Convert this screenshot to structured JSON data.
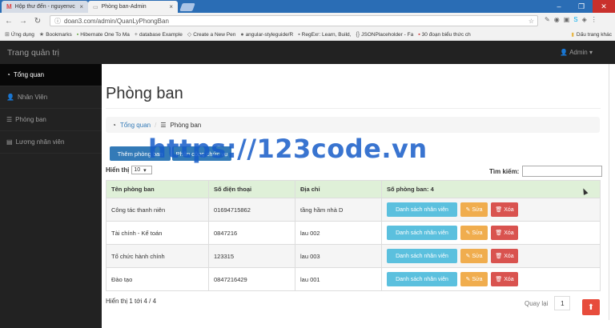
{
  "browser": {
    "tabs": [
      {
        "label": "Hộp thư đến - nguyenvc",
        "icon": "gmail-icon",
        "active": false
      },
      {
        "label": "Phòng ban-Admin",
        "icon": "page-icon",
        "active": true
      }
    ],
    "url": "doan3.com/admin/QuanLyPhongBan",
    "bookmarks": [
      {
        "label": "Ứng dụng"
      },
      {
        "label": "Bookmarks"
      },
      {
        "label": "Hibernate One To Ma"
      },
      {
        "label": "database Example"
      },
      {
        "label": "Create a New Pen"
      },
      {
        "label": "angular-styleguide/R"
      },
      {
        "label": "RegExr: Learn, Build,"
      },
      {
        "label": "JSONPlaceholder - Fa"
      },
      {
        "label": "30 đoạn biểu thức ch"
      }
    ],
    "bookmarks_right": "Dấu trang khác"
  },
  "app": {
    "brand": "Trang quản trị",
    "user": "Admin"
  },
  "sidebar": {
    "items": [
      {
        "label": "Tổng quan",
        "active": true
      },
      {
        "label": "Nhân Viên",
        "active": false
      },
      {
        "label": "Phòng ban",
        "active": false
      },
      {
        "label": "Lương nhân viên",
        "active": false
      }
    ]
  },
  "main": {
    "title": "Phòng ban",
    "breadcrumb": {
      "home": "Tổng quan",
      "current": "Phòng ban"
    },
    "add_button": "Thêm phòng ban",
    "second_button": "Phân công chức vụ",
    "length": {
      "label": "Hiển thị",
      "value": "10"
    },
    "search_label": "Tìm kiếm:",
    "table": {
      "headers": [
        "Tên phòng ban",
        "Số điện thoại",
        "Địa chỉ",
        "Số phòng ban: 4"
      ],
      "rows": [
        {
          "name": "Công tác thanh niên",
          "phone": "01694715862",
          "address": "tầng hầm nhà D"
        },
        {
          "name": "Tài chính - Kế toán",
          "phone": "0847216",
          "address": "lau 002"
        },
        {
          "name": "Tổ chức hành chính",
          "phone": "123315",
          "address": "lau 003"
        },
        {
          "name": "Đào tạo",
          "phone": "0847216429",
          "address": "lau 001"
        }
      ],
      "actions": {
        "list": "Danh sách nhân viên",
        "edit": "Sửa",
        "delete": "Xóa"
      }
    },
    "info": "Hiển thị 1 tới 4 / 4",
    "pager": {
      "back": "Quay lại",
      "page": "1"
    }
  },
  "watermark": "https://123code.vn"
}
